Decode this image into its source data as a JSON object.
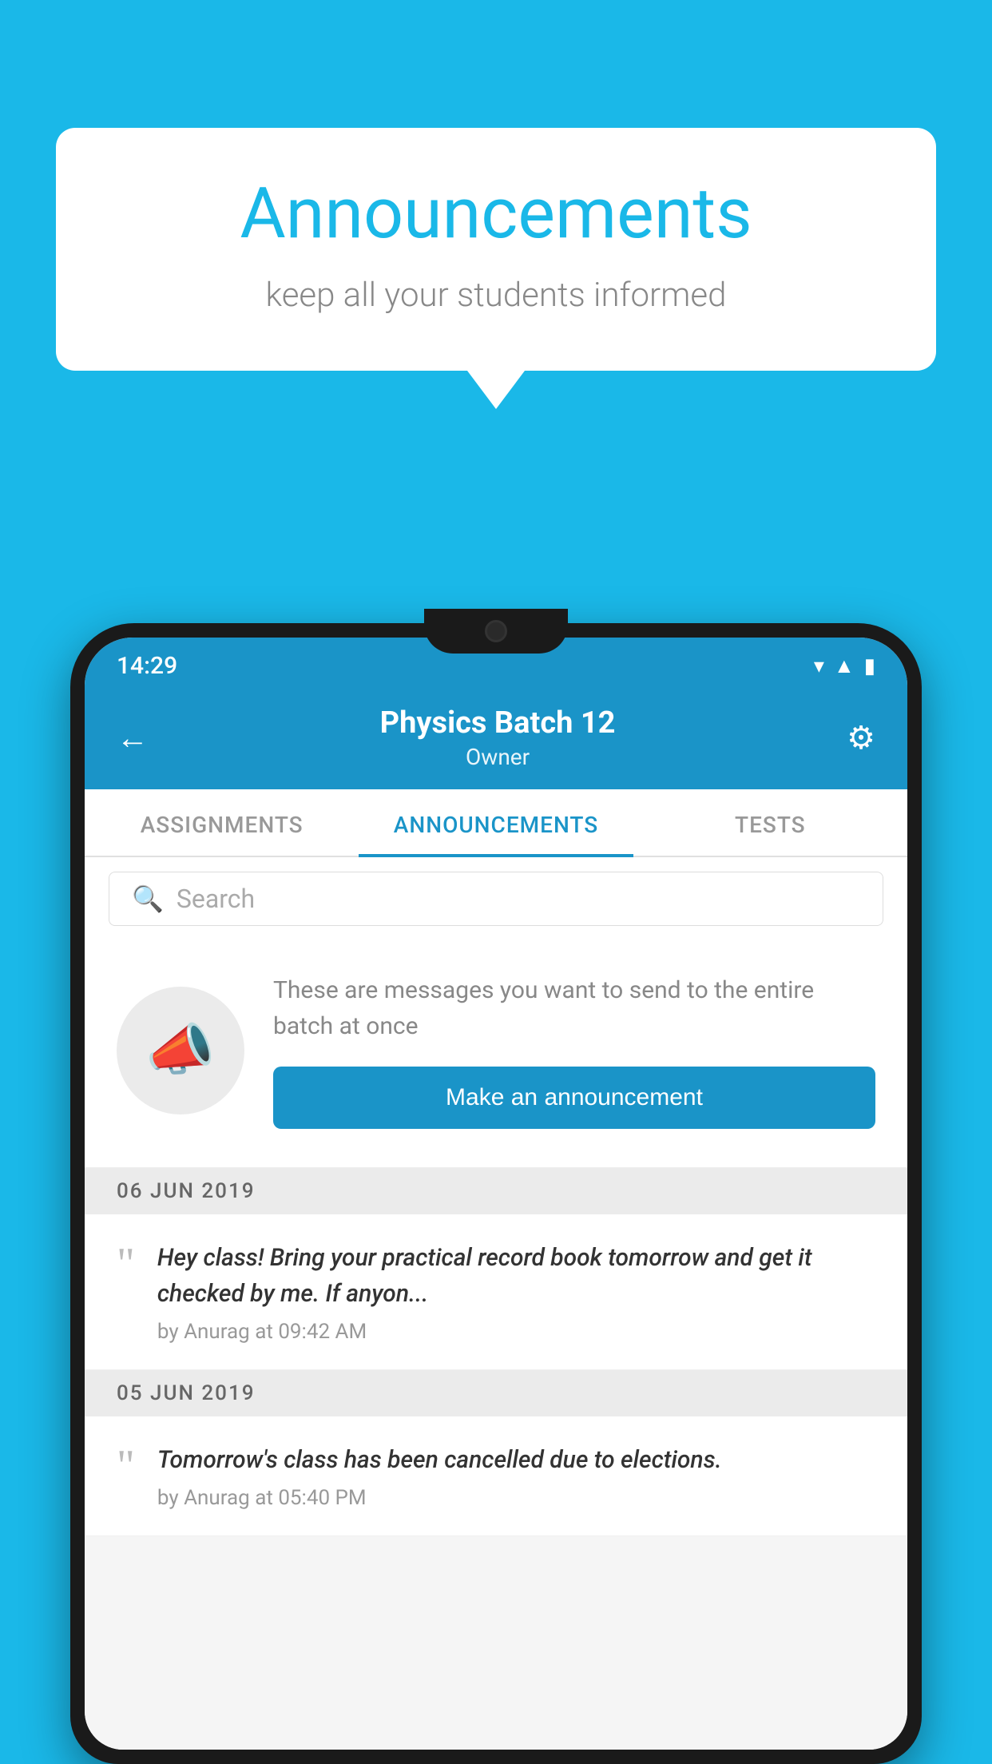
{
  "background_color": "#1ab8e8",
  "speech_bubble": {
    "title": "Announcements",
    "subtitle": "keep all your students informed"
  },
  "phone": {
    "status_bar": {
      "time": "14:29",
      "wifi": "▾",
      "signal": "▲",
      "battery": "▮"
    },
    "header": {
      "back_icon": "←",
      "title": "Physics Batch 12",
      "subtitle": "Owner",
      "gear_icon": "⚙"
    },
    "tabs": [
      {
        "label": "ASSIGNMENTS",
        "active": false
      },
      {
        "label": "ANNOUNCEMENTS",
        "active": true
      },
      {
        "label": "TESTS",
        "active": false
      },
      {
        "label": "...",
        "active": false
      }
    ],
    "search": {
      "placeholder": "Search",
      "icon": "🔍"
    },
    "announcement_intro": {
      "description": "These are messages you want to\nsend to the entire batch at once",
      "button_label": "Make an announcement"
    },
    "announcements": [
      {
        "date": "06  JUN  2019",
        "text": "Hey class! Bring your practical record book tomorrow and get it checked by me. If anyon...",
        "meta": "by Anurag at 09:42 AM"
      },
      {
        "date": "05  JUN  2019",
        "text": "Tomorrow's class has been cancelled due to elections.",
        "meta": "by Anurag at 05:40 PM"
      }
    ]
  }
}
